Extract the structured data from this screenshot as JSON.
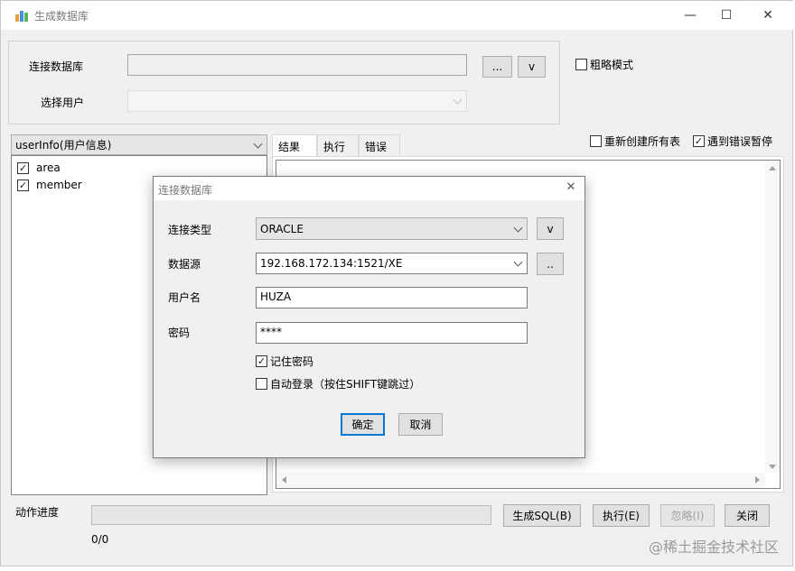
{
  "window": {
    "title": "生成数据库",
    "minimize_glyph": "—",
    "maximize_glyph": "☐",
    "close_glyph": "✕"
  },
  "connect": {
    "db_label": "连接数据库",
    "db_value": "",
    "browse_label": "...",
    "v_label": "v",
    "user_label": "选择用户",
    "user_value": ""
  },
  "options": {
    "rough_mode": {
      "label": "粗略模式",
      "checked": false
    },
    "recreate_all": {
      "label": "重新创建所有表",
      "checked": false
    },
    "pause_on_error": {
      "label": "遇到错误暂停",
      "checked": true
    }
  },
  "schema_select": {
    "value": "userInfo(用户信息)"
  },
  "tables": [
    {
      "label": "area",
      "checked": true
    },
    {
      "label": "member",
      "checked": true
    }
  ],
  "tabs": [
    {
      "label": "结果",
      "active": true
    },
    {
      "label": "执行",
      "active": false
    },
    {
      "label": "错误",
      "active": false
    }
  ],
  "footer": {
    "progress_label": "动作进度",
    "progress_text": "0/0",
    "gen_sql_label": "生成SQL(B)",
    "exec_label": "执行(E)",
    "ignore_label": "忽略(I)",
    "close_label": "关闭"
  },
  "dialog": {
    "title": "连接数据库",
    "close_glyph": "✕",
    "conn_type_label": "连接类型",
    "conn_type_value": "ORACLE",
    "v_label": "v",
    "datasource_label": "数据源",
    "datasource_value": "192.168.172.134:1521/XE",
    "browse_label": "..",
    "username_label": "用户名",
    "username_value": "HUZA",
    "password_label": "密码",
    "password_value": "****",
    "remember_label": "记住密码",
    "remember_checked": true,
    "autologin_label": "自动登录（按住SHIFT键跳过）",
    "autologin_checked": false,
    "ok_label": "确定",
    "cancel_label": "取消"
  },
  "watermark": "@稀土掘金技术社区"
}
